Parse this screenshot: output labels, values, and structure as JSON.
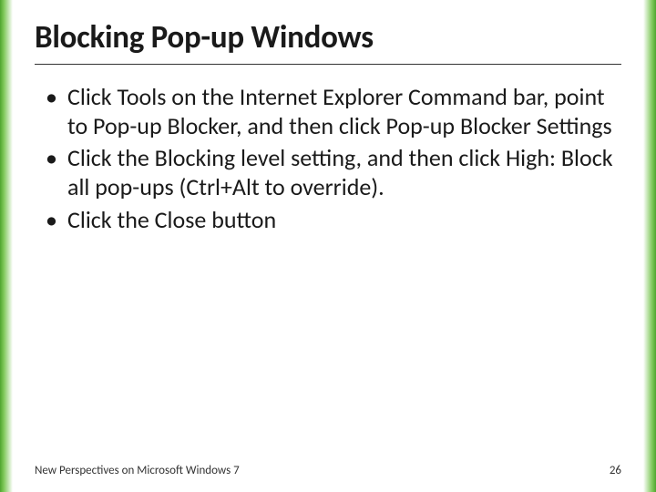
{
  "slide": {
    "title": "Blocking Pop-up Windows",
    "bullets": [
      "Click Tools on the Internet Explorer Command bar, point to Pop-up Blocker, and then click Pop-up Blocker Settings",
      "Click the Blocking level setting, and then click High: Block all pop-ups (Ctrl+Alt to override).",
      "Click the Close button"
    ]
  },
  "footer": {
    "source": "New Perspectives on Microsoft Windows 7",
    "page": "26"
  },
  "colors": {
    "accent": "#4fa52f"
  }
}
